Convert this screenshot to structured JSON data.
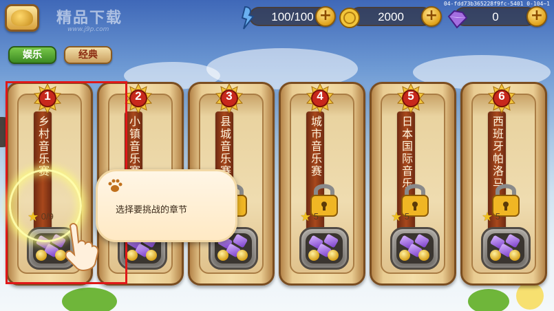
{
  "topbar": {
    "watermark": "精品下载",
    "watermark_url": "www.j9p.com",
    "energy": "100/100",
    "coins": "2000",
    "gems": "0",
    "plus": "+",
    "debug_id": "04-fdd73b365228f9fc-5401 0-104~1"
  },
  "modes": {
    "entertainment": "娱乐",
    "classic": "经典"
  },
  "chapters": [
    {
      "number": "1",
      "title": "乡村音乐赛",
      "locked": false,
      "stars": "0/9"
    },
    {
      "number": "2",
      "title": "小镇音乐赛",
      "locked": false,
      "stars": ""
    },
    {
      "number": "3",
      "title": "县城音乐赛",
      "locked": true,
      "stars": "5"
    },
    {
      "number": "4",
      "title": "城市音乐赛",
      "locked": true,
      "stars": "5"
    },
    {
      "number": "5",
      "title": "日本国际音乐",
      "locked": true,
      "stars": "5"
    },
    {
      "number": "6",
      "title": "西班牙帕洛马",
      "locked": true,
      "stars": "5"
    }
  ],
  "tutorial": {
    "hint": "选择要挑战的章节"
  },
  "colors": {
    "highlight": "#e01818",
    "ribbon": "#a8481c",
    "card": "#f4dfaa",
    "tab_entertainment": "#3c8a22"
  }
}
